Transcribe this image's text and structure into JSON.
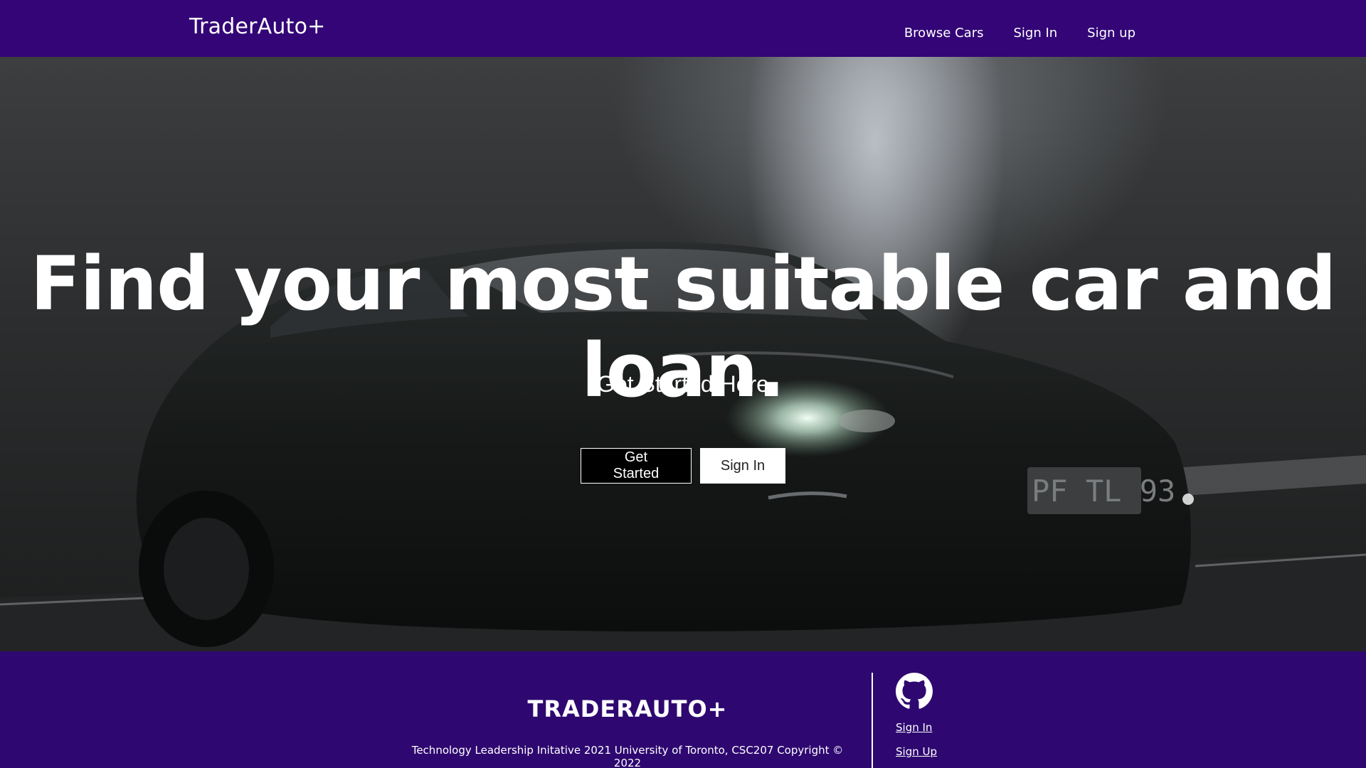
{
  "navbar": {
    "brand": "TraderAuto+",
    "links": [
      "Browse Cars",
      "Sign In",
      "Sign up"
    ]
  },
  "hero": {
    "title": "Find your most suitable car and loan.",
    "subtitle": "Get Started Here",
    "primary_button": "Get Started",
    "secondary_button": "Sign In",
    "plate_text": "PF TL 93"
  },
  "footer": {
    "brand": "TRADERAUTO+",
    "copyright": "Technology Leadership Initative 2021 University of Toronto, CSC207 Copyright © 2022",
    "links": [
      "Sign In",
      "Sign Up"
    ],
    "icon": "github-icon"
  },
  "colors": {
    "navbar_bg": "#330577",
    "footer_bg": "#2e0870",
    "text": "#ffffff"
  }
}
